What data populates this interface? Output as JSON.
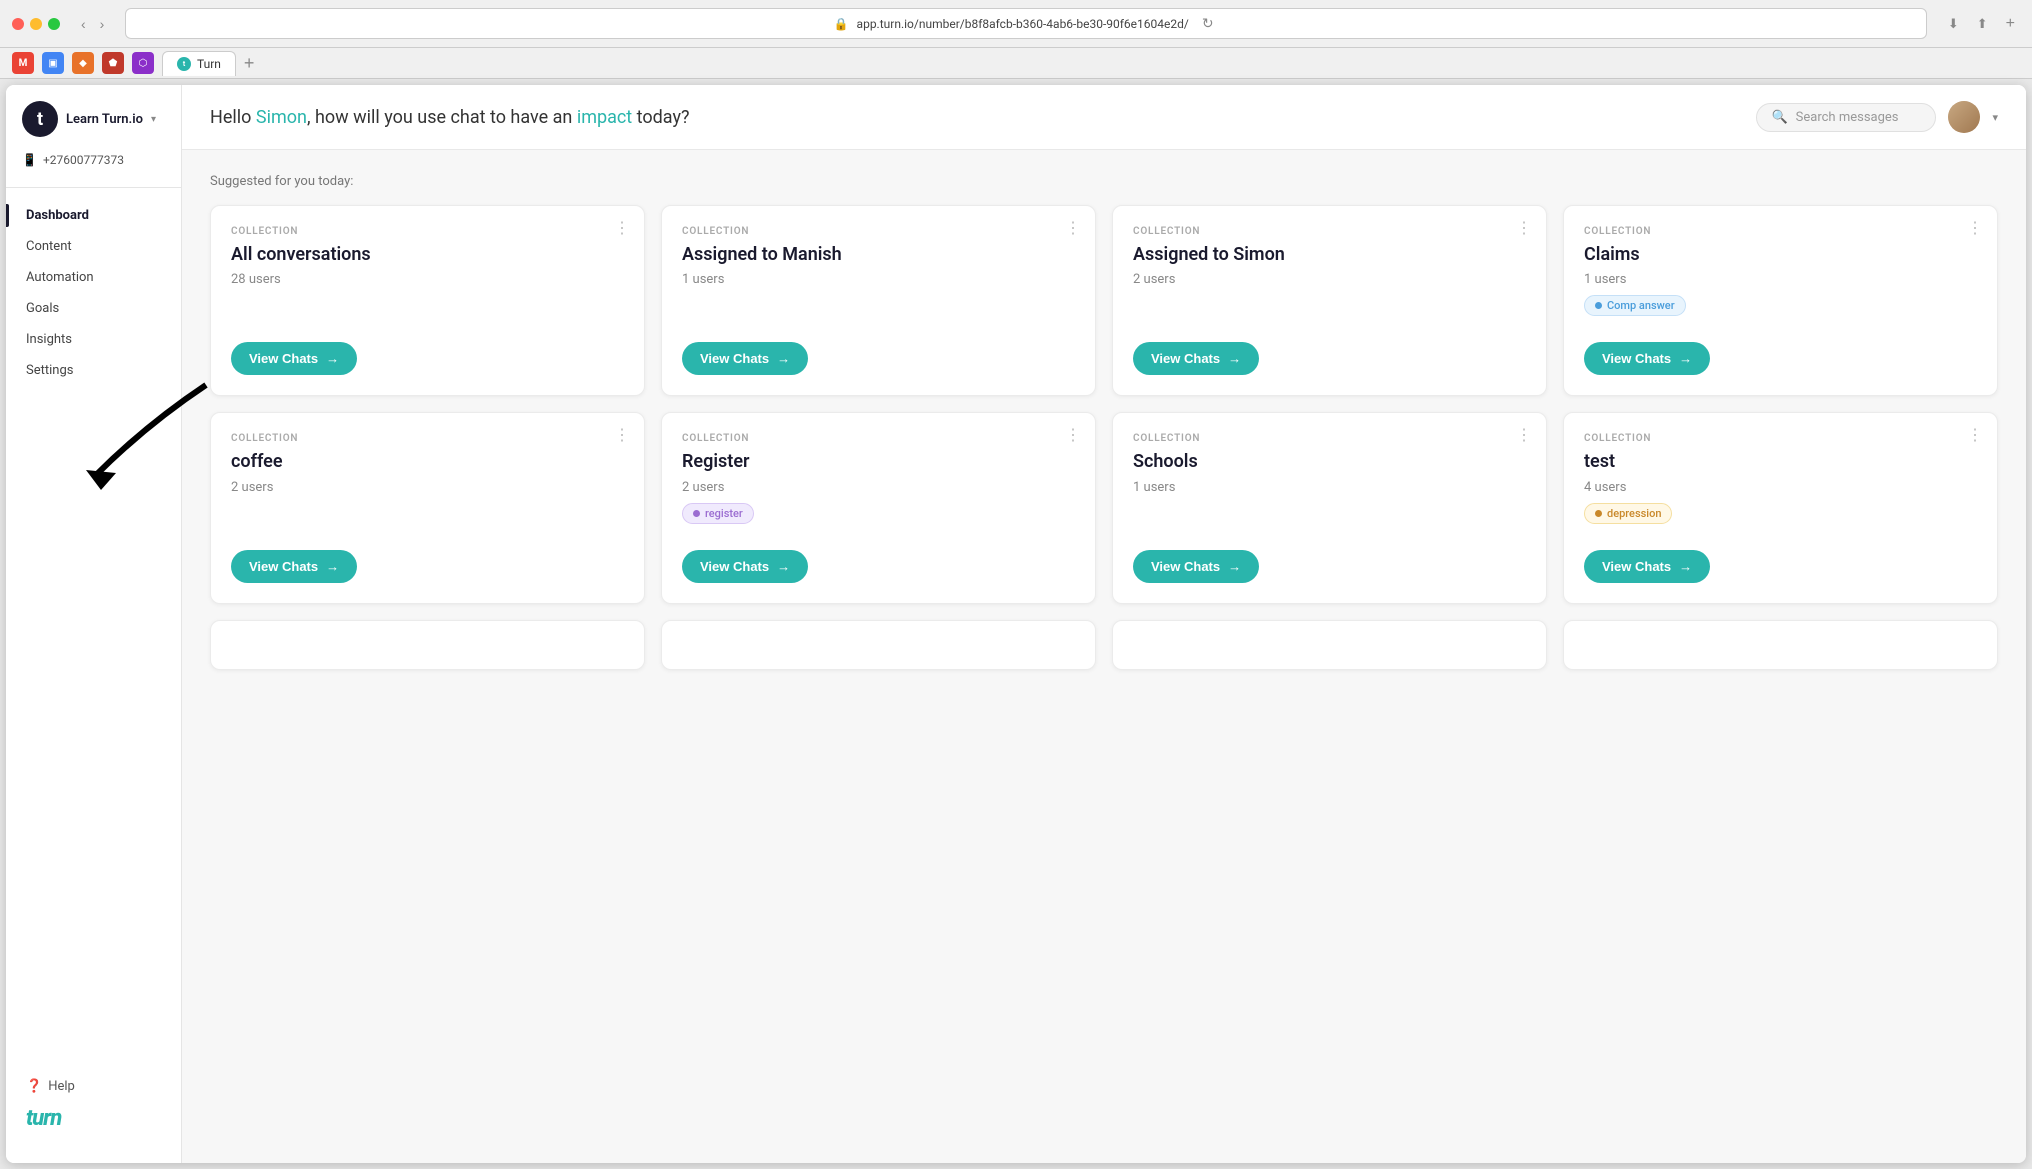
{
  "browser": {
    "url": "app.turn.io/number/b8f8afcb-b360-4ab6-be30-90f6e1604e2d/",
    "tab_label": "Turn",
    "favicon_letter": "t"
  },
  "header": {
    "greeting_prefix": "Hello ",
    "user_name": "Simon",
    "greeting_middle": ", how will you use chat to have an ",
    "impact_word": "impact",
    "greeting_suffix": " today?",
    "search_placeholder": "Search messages",
    "avatar_alt": "User avatar"
  },
  "sidebar": {
    "org_name": "Learn Turn.io",
    "phone": "+27600777373",
    "logo_letter": "t",
    "nav_items": [
      {
        "label": "Dashboard",
        "active": true
      },
      {
        "label": "Content",
        "active": false
      },
      {
        "label": "Automation",
        "active": false
      },
      {
        "label": "Goals",
        "active": false
      },
      {
        "label": "Insights",
        "active": false
      },
      {
        "label": "Settings",
        "active": false
      }
    ],
    "help_label": "Help",
    "brand_name": "turn"
  },
  "content": {
    "suggested_label": "Suggested for you today:",
    "cards_row1": [
      {
        "collection_label": "COLLECTION",
        "title": "All conversations",
        "users": "28 users",
        "tags": [],
        "btn_label": "View Chats",
        "menu": "⋮"
      },
      {
        "collection_label": "COLLECTION",
        "title": "Assigned to Manish",
        "users": "1 users",
        "tags": [],
        "btn_label": "View Chats",
        "menu": "⋮"
      },
      {
        "collection_label": "COLLECTION",
        "title": "Assigned to Simon",
        "users": "2 users",
        "tags": [],
        "btn_label": "View Chats",
        "menu": "⋮"
      },
      {
        "collection_label": "COLLECTION",
        "title": "Claims",
        "users": "1 users",
        "tags": [
          {
            "label": "Comp answer",
            "style": "blue"
          }
        ],
        "btn_label": "View Chats",
        "menu": "⋮"
      }
    ],
    "cards_row2": [
      {
        "collection_label": "COLLECTION",
        "title": "coffee",
        "users": "2 users",
        "tags": [],
        "btn_label": "View Chats",
        "menu": "⋮"
      },
      {
        "collection_label": "COLLECTION",
        "title": "Register",
        "users": "2 users",
        "tags": [
          {
            "label": "register",
            "style": "purple"
          }
        ],
        "btn_label": "View Chats",
        "menu": "⋮"
      },
      {
        "collection_label": "COLLECTION",
        "title": "Schools",
        "users": "1 users",
        "tags": [],
        "btn_label": "View Chats",
        "menu": "⋮"
      },
      {
        "collection_label": "COLLECTION",
        "title": "test",
        "users": "4 users",
        "tags": [
          {
            "label": "depression",
            "style": "orange"
          }
        ],
        "btn_label": "View Chats",
        "menu": "⋮"
      }
    ]
  }
}
